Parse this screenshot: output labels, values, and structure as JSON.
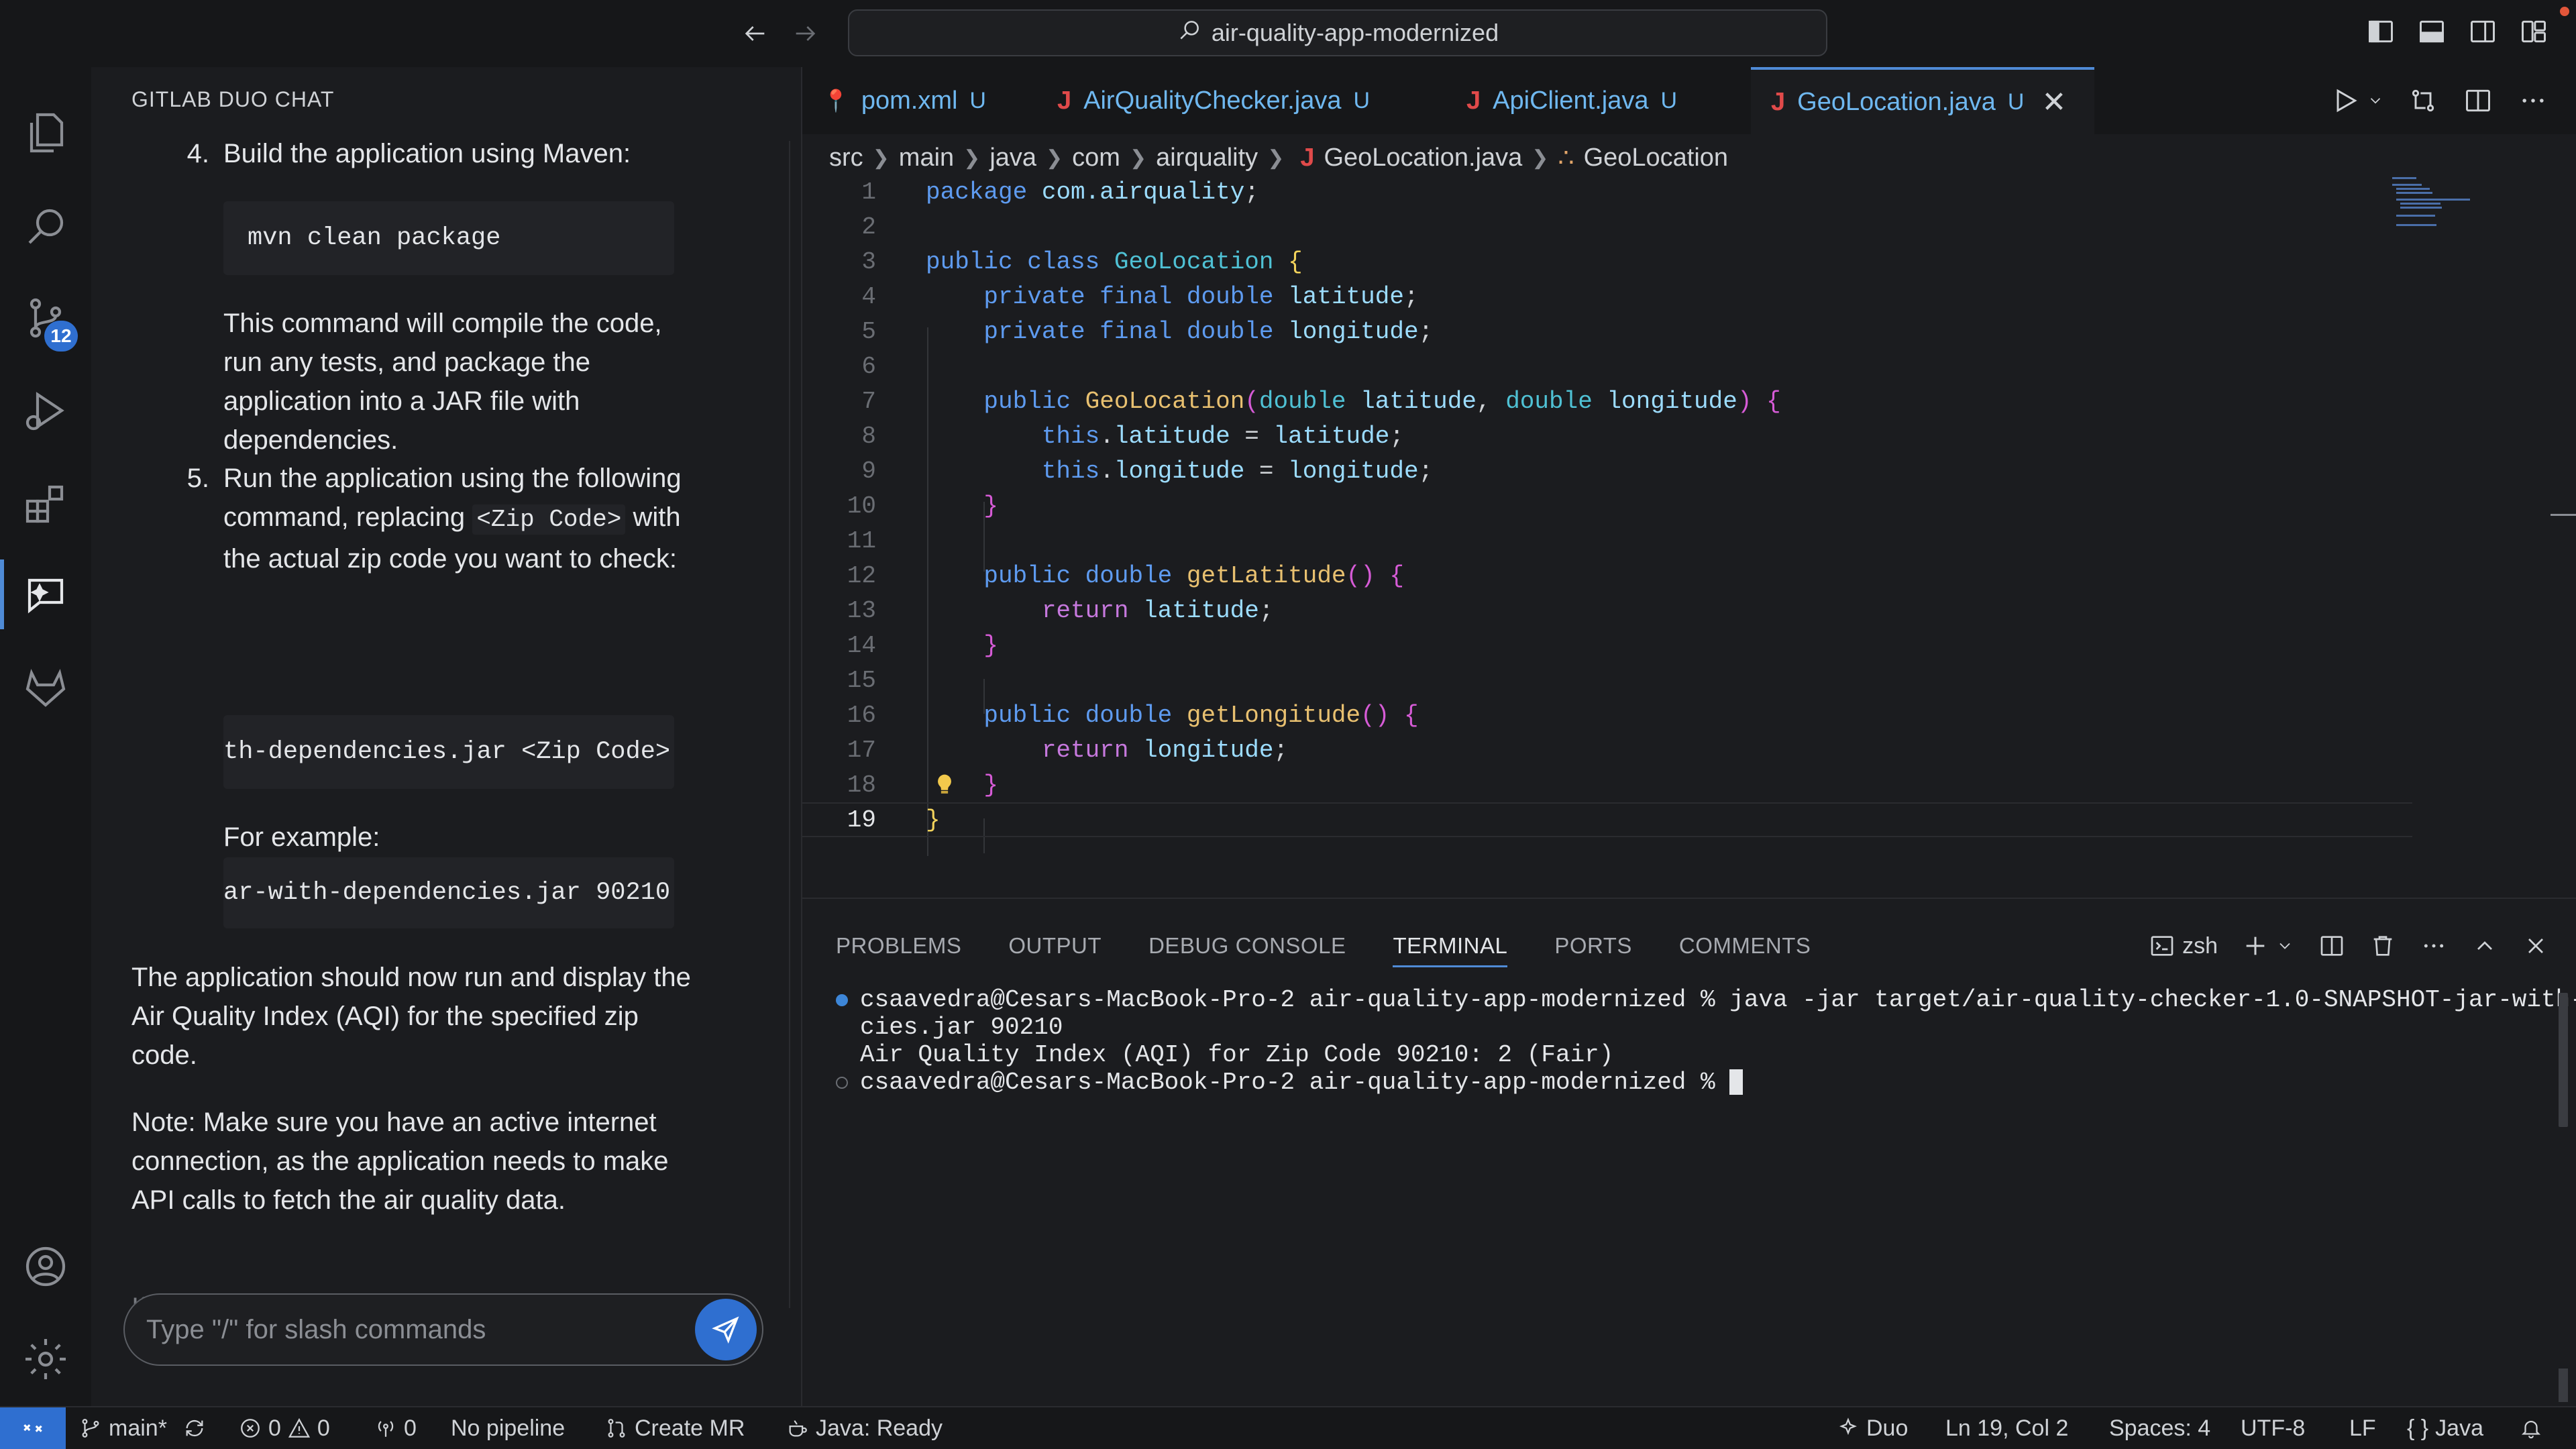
{
  "titlebar": {
    "search_text": "air-quality-app-modernized"
  },
  "activity": {
    "source_control_badge": "12"
  },
  "chat": {
    "title": "GITLAB DUO CHAT",
    "step4_num": "4.",
    "step4_text": "Build the application using Maven:",
    "code1": "mvn clean package",
    "para1": "This command will compile the code, run any tests, and package the application into a JAR file with dependencies.",
    "step5_num": "5.",
    "step5_text_a": "Run the application using the following command, replacing",
    "step5_code": "<Zip Code>",
    "step5_text_b": "with the actual zip code you want to check:",
    "code2": "th-dependencies.jar <Zip Code>",
    "for_example": "For example:",
    "code3": "ar-with-dependencies.jar 90210",
    "para2": "The application should now run and display the Air Quality Index (AQI) for the specified zip code.",
    "para3": "Note: Make sure you have an active internet connection, as the application needs to make API calls to fetch the air quality data.",
    "para4_faded": "If you make any changes to the code,",
    "input_placeholder": "Type \"/\" for slash commands"
  },
  "tabs": [
    {
      "label": "pom.xml",
      "status": "U",
      "icon": "xml-icon"
    },
    {
      "label": "AirQualityChecker.java",
      "status": "U",
      "icon": "java-icon"
    },
    {
      "label": "ApiClient.java",
      "status": "U",
      "icon": "java-icon"
    },
    {
      "label": "GeoLocation.java",
      "status": "U",
      "icon": "java-icon",
      "active": true
    }
  ],
  "breadcrumb": [
    "src",
    "main",
    "java",
    "com",
    "airquality",
    "GeoLocation.java",
    "GeoLocation"
  ],
  "code": {
    "line_numbers": [
      "1",
      "2",
      "3",
      "4",
      "5",
      "6",
      "7",
      "8",
      "9",
      "10",
      "11",
      "12",
      "13",
      "14",
      "15",
      "16",
      "17",
      "18",
      "19"
    ],
    "current_line": "19"
  },
  "panel": {
    "tabs": [
      "PROBLEMS",
      "OUTPUT",
      "DEBUG CONSOLE",
      "TERMINAL",
      "PORTS",
      "COMMENTS"
    ],
    "active_tab": "TERMINAL",
    "shell": "zsh",
    "terminal_lines": [
      "csaavedra@Cesars-MacBook-Pro-2 air-quality-app-modernized % java -jar target/air-quality-checker-1.0-SNAPSHOT-jar-with-dependen",
      "cies.jar 90210",
      "Air Quality Index (AQI) for Zip Code 90210: 2 (Fair)",
      "csaavedra@Cesars-MacBook-Pro-2 air-quality-app-modernized % "
    ]
  },
  "statusbar": {
    "branch": "main*",
    "errors": "0",
    "warnings": "0",
    "ports": "0",
    "pipeline": "No pipeline",
    "create_mr": "Create MR",
    "java_status": "Java: Ready",
    "duo": "Duo",
    "position": "Ln 19, Col 2",
    "spaces": "Spaces: 4",
    "encoding": "UTF-8",
    "eol": "LF",
    "language": "Java"
  },
  "colors": {
    "accent": "#2f6fd0",
    "untracked": "#6fb8f0",
    "java_icon": "#e04a4a"
  }
}
